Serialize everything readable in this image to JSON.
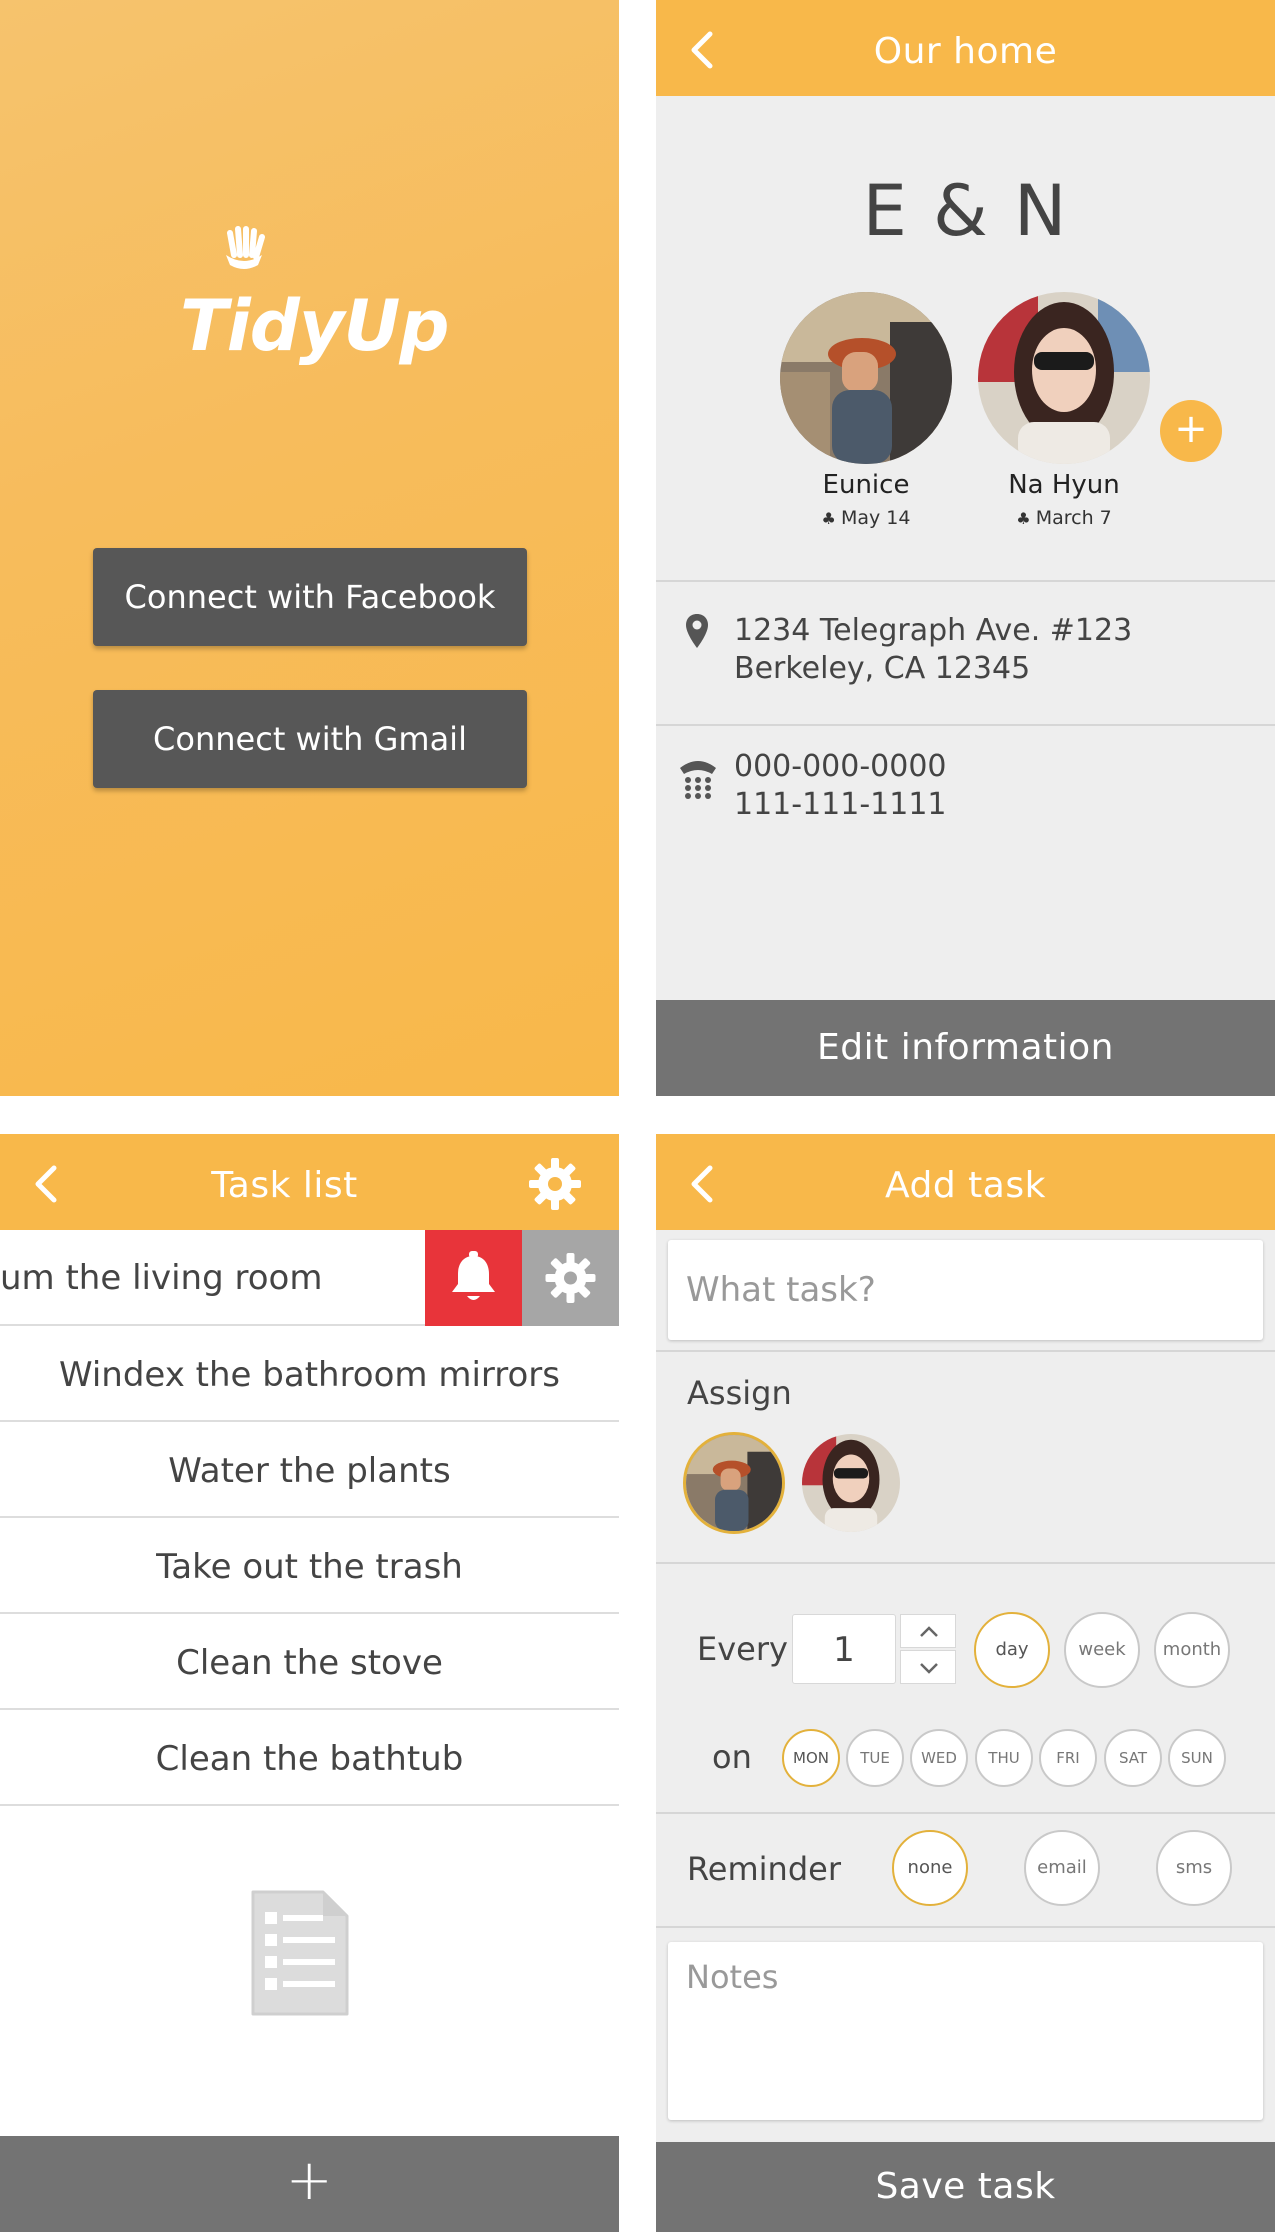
{
  "login": {
    "logo": "TidyUp",
    "facebook_button": "Connect with Facebook",
    "gmail_button": "Connect with Gmail"
  },
  "home": {
    "header_title": "Our home",
    "home_name": "E & N",
    "members": [
      {
        "name": "Eunice",
        "date": "May 14"
      },
      {
        "name": "Na Hyun",
        "date": "March 7"
      }
    ],
    "add_member": "+",
    "address_line1": "1234 Telegraph Ave. #123",
    "address_line2": "Berkeley, CA 12345",
    "phone1": "000-000-0000",
    "phone2": "111-111-1111",
    "edit_button": "Edit information"
  },
  "tasks": {
    "header_title": "Task list",
    "swiped_task": "um the living room",
    "items": [
      "Windex the bathroom mirrors",
      "Water the plants",
      "Take out the trash",
      "Clean the stove",
      "Clean the bathtub"
    ],
    "add_button": "+"
  },
  "add_task": {
    "header_title": "Add task",
    "task_placeholder": "What task?",
    "assign_label": "Assign",
    "every_label": "Every",
    "every_value": "1",
    "period_options": [
      "day",
      "week",
      "month"
    ],
    "period_selected": "day",
    "on_label": "on",
    "days": [
      "MON",
      "TUE",
      "WED",
      "THU",
      "FRI",
      "SAT",
      "SUN"
    ],
    "day_selected": "MON",
    "reminder_label": "Reminder",
    "reminder_options": [
      "none",
      "email",
      "sms"
    ],
    "reminder_selected": "none",
    "notes_placeholder": "Notes",
    "save_button": "Save task"
  },
  "colors": {
    "accent": "#f8b84a",
    "dark_button": "#575757",
    "footer": "#737373",
    "alert_red": "#e8343a",
    "selected_ring": "#e3b13b"
  }
}
